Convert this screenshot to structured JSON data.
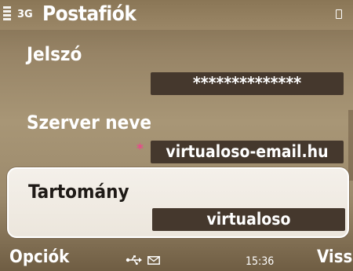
{
  "status": {
    "network": "3G",
    "title": "Postafiók"
  },
  "fields": {
    "password": {
      "label": "Jelszó",
      "value": "**************"
    },
    "server": {
      "label": "Szerver neve",
      "value": "virtualoso-email.hu",
      "required_marker": "*"
    },
    "domain": {
      "label": "Tartomány",
      "value": "virtualoso"
    }
  },
  "softkeys": {
    "left": "Opciók",
    "right": "Vissza",
    "time": "15:36"
  },
  "icons": {
    "status": [
      "signal-strength-icon",
      "battery-icon"
    ],
    "bottom": [
      "usb-icon",
      "mail-icon"
    ]
  },
  "colors": {
    "background": "#a89676",
    "value_box": "#45382d",
    "highlight": "#f2eee7",
    "required_marker": "#e84a8a"
  }
}
